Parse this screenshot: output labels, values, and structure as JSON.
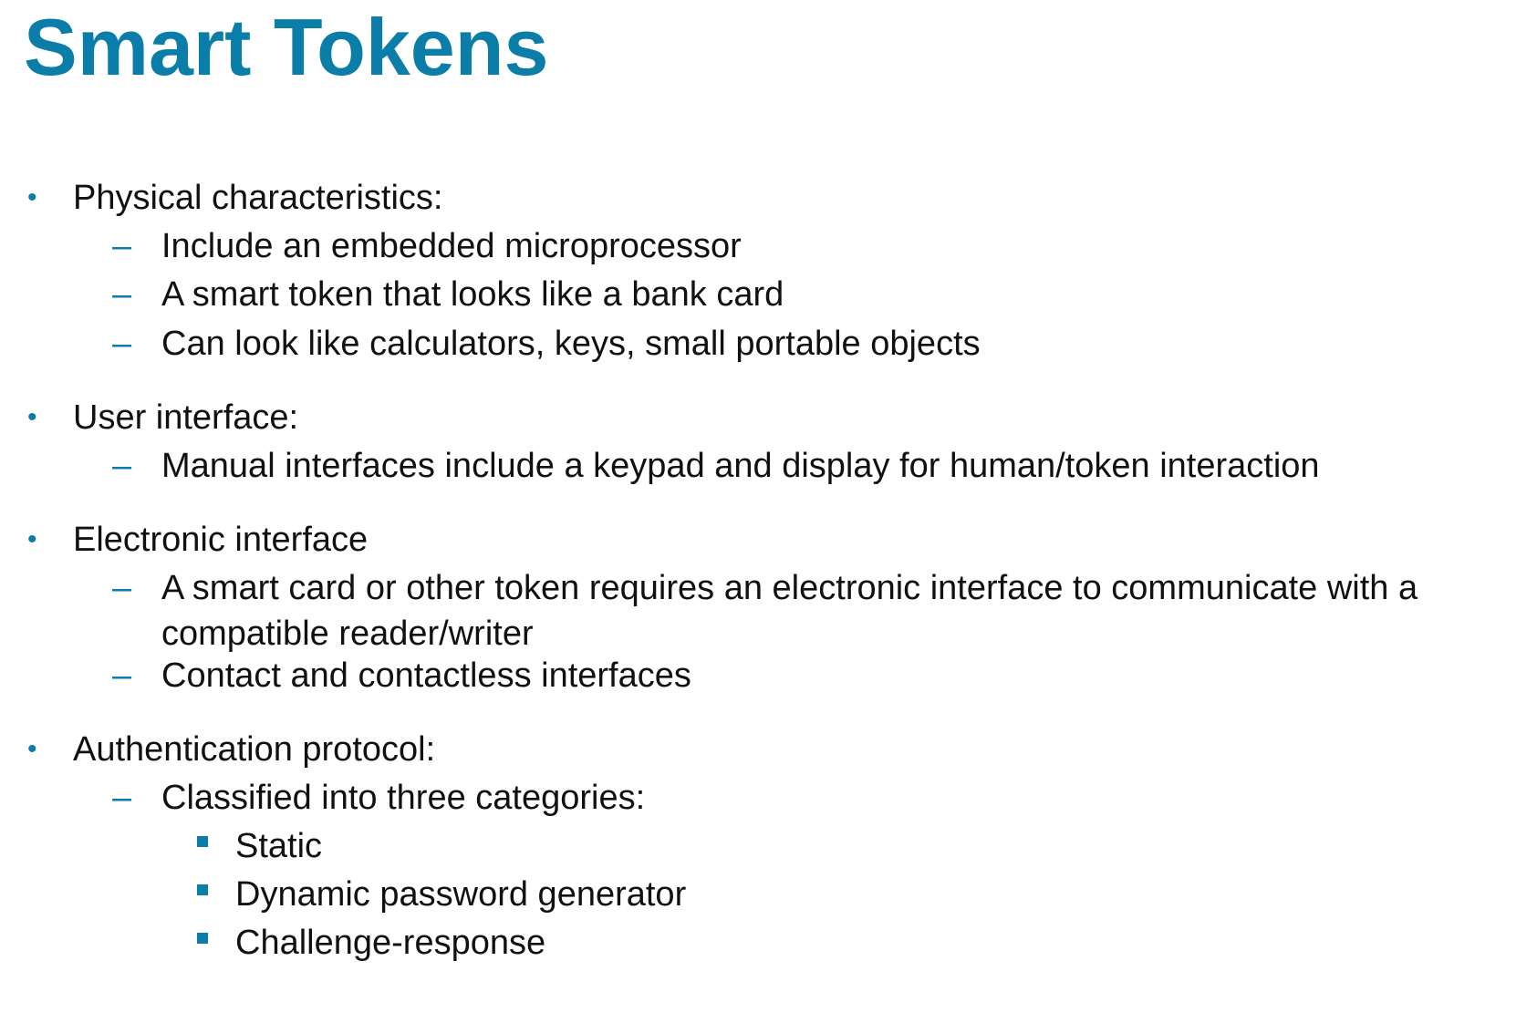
{
  "title": "Smart Tokens",
  "accent_color": "#0a7ea8",
  "sections": [
    {
      "heading": "Physical characteristics:",
      "items": [
        "Include an embedded microprocessor",
        "A smart token that looks like a bank card",
        "Can look like calculators, keys, small portable objects"
      ]
    },
    {
      "heading": "User interface:",
      "items": [
        "Manual interfaces include a keypad and display for human/token interaction"
      ]
    },
    {
      "heading": "Electronic interface",
      "items": [
        "A smart card or other token requires an electronic interface to communicate with a compatible reader/writer",
        "Contact and contactless interfaces"
      ]
    },
    {
      "heading": "Authentication protocol:",
      "items": [
        "Classified into three categories:"
      ],
      "subitems": [
        "Static",
        "Dynamic password generator",
        "Challenge-response"
      ]
    }
  ]
}
